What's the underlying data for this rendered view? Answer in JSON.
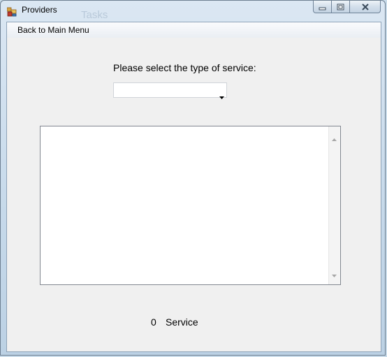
{
  "window": {
    "title": "Providers",
    "background_ghost_text": "Tasks",
    "icons": [
      "app-icon",
      "minimize-icon",
      "maximize-icon",
      "close-icon"
    ]
  },
  "menu": {
    "items": [
      {
        "label": "Back to Main Menu"
      }
    ]
  },
  "service_selector": {
    "prompt": "Please select the type of service:",
    "selected_value": ""
  },
  "results_list": {
    "items": []
  },
  "footer": {
    "count": "0",
    "count_label": "Service"
  }
}
